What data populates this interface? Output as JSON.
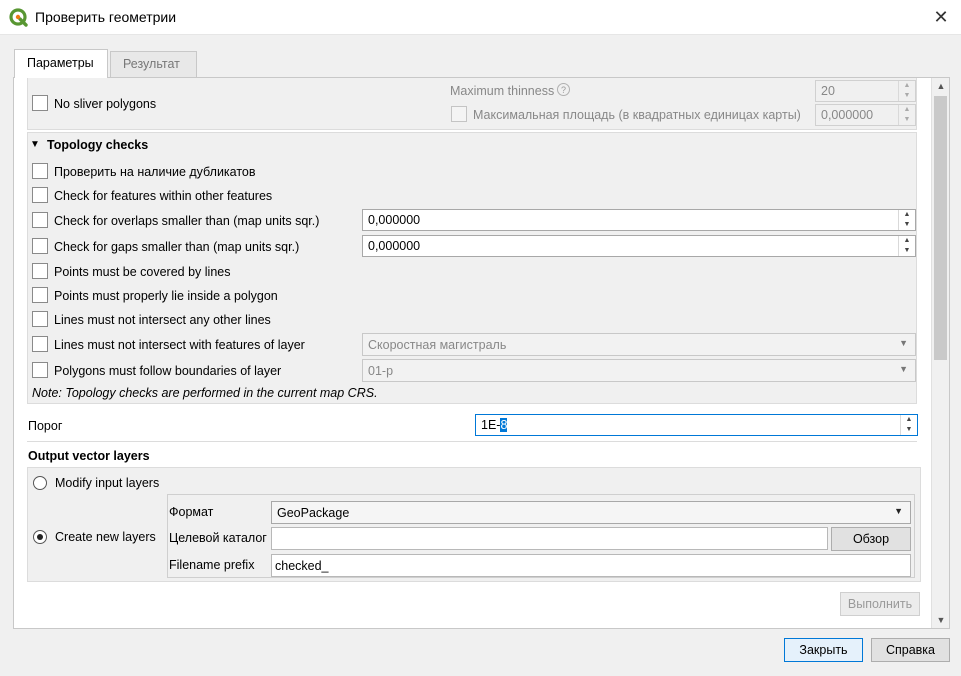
{
  "window": {
    "title": "Проверить геометрии",
    "close_icon": "close-icon"
  },
  "tabs": [
    {
      "label": "Параметры",
      "active": true
    },
    {
      "label": "Результат",
      "active": false
    }
  ],
  "sliver": {
    "checkbox_label": "No sliver polygons",
    "max_thinness_label": "Maximum thinness",
    "max_thinness_value": "20",
    "max_area_label": "Максимальная площадь (в квадратных единицах карты)",
    "max_area_value": "0,000000"
  },
  "topology": {
    "title": "Topology checks",
    "items": [
      {
        "label": "Проверить на наличие дубликатов"
      },
      {
        "label": "Check for features within other features"
      },
      {
        "label": "Check for overlaps smaller than (map units sqr.)",
        "value": "0,000000"
      },
      {
        "label": "Check for gaps smaller than (map units sqr.)",
        "value": "0,000000"
      },
      {
        "label": "Points must be covered by lines"
      },
      {
        "label": "Points must properly lie inside a polygon"
      },
      {
        "label": "Lines must not intersect any other lines"
      },
      {
        "label": "Lines must not intersect with features of layer",
        "combo": "Скоростная магистраль"
      },
      {
        "label": "Polygons must follow boundaries of layer",
        "combo": "01-р"
      }
    ],
    "note": "Note: Topology checks are performed in the current map CRS."
  },
  "threshold": {
    "label": "Порог",
    "value_prefix": "1E-",
    "value_selected": "8"
  },
  "output": {
    "title": "Output vector layers",
    "modify_label": "Modify input layers",
    "create_label": "Create new layers",
    "format_label": "Формат",
    "format_value": "GeoPackage",
    "target_dir_label": "Целевой каталог",
    "target_dir_value": "",
    "browse_label": "Обзор",
    "prefix_label": "Filename prefix",
    "prefix_value": "checked_"
  },
  "buttons": {
    "run": "Выполнить",
    "close": "Закрыть",
    "help": "Справка"
  },
  "colors": {
    "accent": "#0078d7",
    "qgis_green": "#589632",
    "qgis_yellow": "#ee7913"
  }
}
